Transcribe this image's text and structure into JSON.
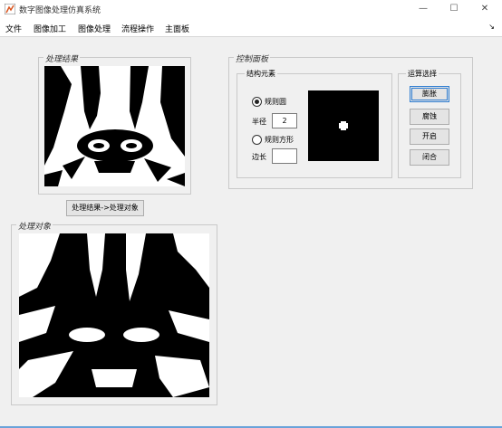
{
  "window": {
    "title": "数字图像处理仿真系统",
    "controls": {
      "minimize": "—",
      "maximize": "☐",
      "close": "✕"
    }
  },
  "menu": {
    "items": [
      "文件",
      "图像加工",
      "图像处理",
      "流程操作",
      "主面板"
    ],
    "expand_glyph": "↘"
  },
  "result_panel": {
    "title": "处理结果",
    "transfer_button": "处理结果->处理对象"
  },
  "object_panel": {
    "title": "处理对象"
  },
  "control_panel": {
    "title": "控制面板",
    "structure_group": {
      "title": "结构元素",
      "disk_label": "规则圆",
      "disk_selected": true,
      "radius_label": "半径",
      "radius_value": "2",
      "square_label": "规则方形",
      "square_selected": false,
      "side_label": "边长",
      "side_value": ""
    },
    "ops_group": {
      "title": "运算选择",
      "buttons": [
        "膨胀",
        "腐蚀",
        "开启",
        "闭合"
      ]
    }
  },
  "colors": {
    "accent": "#2f7dd1",
    "panel_bg": "#f0f0f0"
  }
}
